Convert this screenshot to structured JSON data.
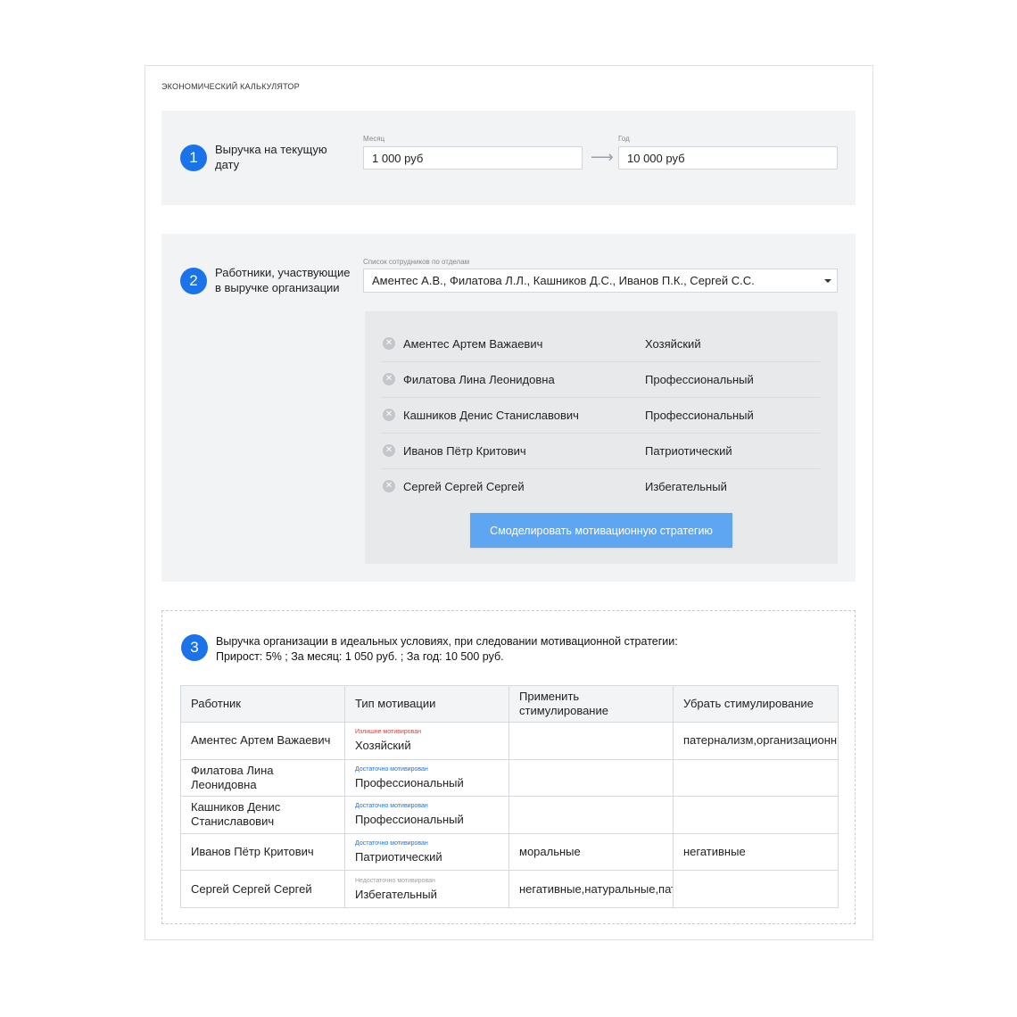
{
  "app": {
    "title": "экономический калькулятор"
  },
  "step1": {
    "number": "1",
    "label": "Выручка на текущую дату",
    "month": {
      "caption": "Месяц",
      "value": "1 000 руб"
    },
    "arrow": "⟶",
    "year": {
      "caption": "Год",
      "value": "10 000 руб"
    }
  },
  "step2": {
    "number": "2",
    "label": "Работники, участвующие в выручке организации",
    "select": {
      "caption": "Список сотрудников по отделам",
      "value": "Аментес А.В., Филатова Л.Л., Кашников Д.С., Иванов П.К., Сергей С.С."
    },
    "employees": [
      {
        "name": "Аментес Артем Важаевич",
        "type": "Хозяйский"
      },
      {
        "name": "Филатова Лина Леонидовна",
        "type": "Профессиональный"
      },
      {
        "name": "Кашников Денис Станиславович",
        "type": "Профессиональный"
      },
      {
        "name": "Иванов Пётр Критович",
        "type": "Патриотический"
      },
      {
        "name": "Сергей Сергей Сергей",
        "type": "Избегательный"
      }
    ],
    "button": "Смоделировать мотивационную стратегию"
  },
  "step3": {
    "number": "3",
    "line1": "Выручка организации в идеальных условиях, при следовании мотивационной стратегии:",
    "line2": "Прирост: 5% ; За месяц: 1 050 руб. ; За год: 10 500 руб.",
    "table": {
      "headers": [
        "Работник",
        "Тип мотивации",
        "Применить стимулирование",
        "Убрать стимулирование"
      ],
      "rows": [
        {
          "worker": "Аментес Артем Важаевич",
          "badge": "Излишне мотивирован",
          "badge_color": "#e53935",
          "type": "Хозяйский",
          "apply": "",
          "remove": "патернализм,организационн"
        },
        {
          "worker": "Филатова Лина Леонидовна",
          "badge": "Достаточно мотивирован",
          "badge_color": "#1a73e8",
          "type": "Профессиональный",
          "apply": "",
          "remove": ""
        },
        {
          "worker": "Кашников Денис Станиславович",
          "badge": "Достаточно мотивирован",
          "badge_color": "#1a73e8",
          "type": "Профессиональный",
          "apply": "",
          "remove": ""
        },
        {
          "worker": "Иванов Пётр Критович",
          "badge": "Достаточно мотивирован",
          "badge_color": "#1a73e8",
          "type": "Патриотический",
          "apply": "моральные",
          "remove": "негативные"
        },
        {
          "worker": "Сергей Сергей Сергей",
          "badge": "Недостаточно мотивирован",
          "badge_color": "#9e9e9e",
          "type": "Избегательный",
          "apply": "негативные,натуральные,патернализм",
          "remove": ""
        }
      ]
    }
  },
  "colors": {
    "accent": "#1a73e8",
    "button": "#5ea5f2",
    "panel": "#f2f3f5"
  },
  "icons": {
    "remove": "close-circle-icon",
    "dropdown": "chevron-down-icon",
    "arrow": "arrow-right-icon"
  }
}
